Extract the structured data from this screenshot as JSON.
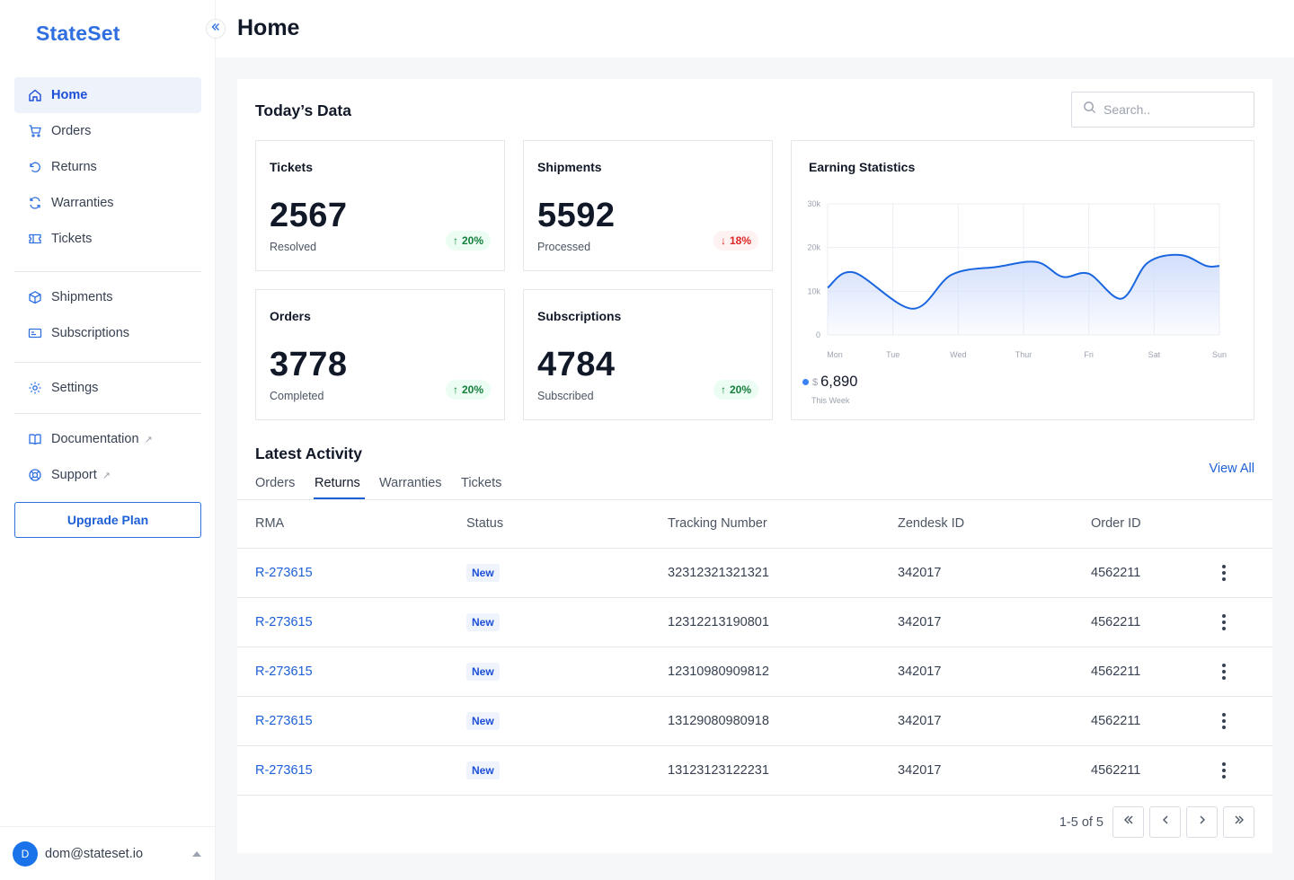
{
  "app": {
    "logo": "StateSet"
  },
  "header": {
    "title": "Home"
  },
  "sidebar": {
    "nav_primary": [
      {
        "label": "Home",
        "icon": "home-icon",
        "active": true
      },
      {
        "label": "Orders",
        "icon": "cart-icon"
      },
      {
        "label": "Returns",
        "icon": "return-icon"
      },
      {
        "label": "Warranties",
        "icon": "refresh-icon"
      },
      {
        "label": "Tickets",
        "icon": "ticket-icon"
      }
    ],
    "nav_secondary": [
      {
        "label": "Shipments",
        "icon": "box-icon"
      },
      {
        "label": "Subscriptions",
        "icon": "card-icon"
      }
    ],
    "nav_settings": [
      {
        "label": "Settings",
        "icon": "gear-icon"
      }
    ],
    "nav_links": [
      {
        "label": "Documentation",
        "icon": "book-icon"
      },
      {
        "label": "Support",
        "icon": "lifebuoy-icon"
      }
    ],
    "upgrade_label": "Upgrade Plan",
    "user": {
      "initial": "D",
      "email": "dom@stateset.io"
    }
  },
  "today": {
    "title": "Today’s Data",
    "search_placeholder": "Search..",
    "cards": [
      {
        "title": "Tickets",
        "value": "2567",
        "sub": "Resolved",
        "trend": "20%",
        "direction": "up"
      },
      {
        "title": "Shipments",
        "value": "5592",
        "sub": "Processed",
        "trend": "18%",
        "direction": "down"
      },
      {
        "title": "Orders",
        "value": "3778",
        "sub": "Completed",
        "trend": "20%",
        "direction": "up"
      },
      {
        "title": "Subscriptions",
        "value": "4784",
        "sub": "Subscribed",
        "trend": "20%",
        "direction": "up"
      }
    ]
  },
  "earnings": {
    "title": "Earning Statistics",
    "currency": "$",
    "value": "6,890",
    "sub": "This Week"
  },
  "chart_data": {
    "type": "area",
    "title": "Earning Statistics",
    "categories": [
      "Mon",
      "Tue",
      "Wed",
      "Thur",
      "Fri",
      "Sat",
      "Sun"
    ],
    "y_ticks": [
      "0",
      "10k",
      "20k",
      "30k"
    ],
    "ylim": [
      0,
      30000
    ],
    "x": [
      0,
      0.4,
      1.3,
      1.9,
      2.6,
      3.2,
      3.6,
      4.0,
      4.5,
      4.9,
      5.4,
      5.8,
      6.0
    ],
    "values": [
      10800,
      14300,
      6000,
      13800,
      15600,
      16700,
      13300,
      14000,
      8300,
      16500,
      18300,
      15800,
      15800
    ],
    "grid": true,
    "line_color": "#1a66e0",
    "fill_color": "#cfdcfb"
  },
  "activity": {
    "title": "Latest Activity",
    "view_all": "View All",
    "tabs": [
      "Orders",
      "Returns",
      "Warranties",
      "Tickets"
    ],
    "active_tab": "Returns",
    "columns": [
      "RMA",
      "Status",
      "Tracking Number",
      "Zendesk ID",
      "Order ID"
    ],
    "rows": [
      {
        "rma": "R-273615",
        "status": "New",
        "tracking": "32312321321321",
        "zendesk": "342017",
        "order": "4562211"
      },
      {
        "rma": "R-273615",
        "status": "New",
        "tracking": "12312213190801",
        "zendesk": "342017",
        "order": "4562211"
      },
      {
        "rma": "R-273615",
        "status": "New",
        "tracking": "12310980909812",
        "zendesk": "342017",
        "order": "4562211"
      },
      {
        "rma": "R-273615",
        "status": "New",
        "tracking": "13129080980918",
        "zendesk": "342017",
        "order": "4562211"
      },
      {
        "rma": "R-273615",
        "status": "New",
        "tracking": "13123123122231",
        "zendesk": "342017",
        "order": "4562211"
      }
    ],
    "pagination": "1-5 of 5"
  },
  "colors": {
    "brand": "#2f6fe0",
    "accent_link": "#1d5fd6",
    "up": "#15803d",
    "down": "#dc2626"
  }
}
